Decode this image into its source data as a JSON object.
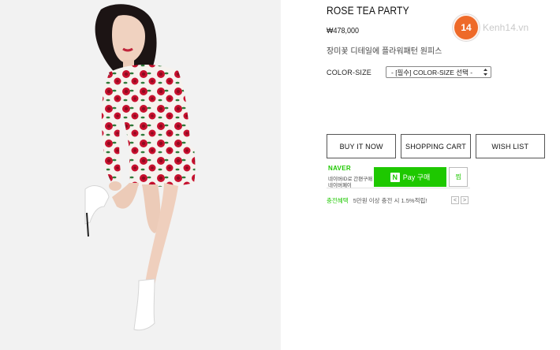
{
  "product": {
    "title": "ROSE TEA PARTY",
    "price": "₩478,000",
    "description": "장미꽃 디테일에 플라워패턴 원피스"
  },
  "option": {
    "label": "COLOR-SIZE",
    "selected": "- [필수] COLOR-SIZE 선택 -"
  },
  "buttons": {
    "buy_now": "BUY IT NOW",
    "shopping_cart": "SHOPPING CART",
    "wish_list": "WISH LIST"
  },
  "naver_pay": {
    "logo": "NAVER",
    "line1": "네이버ID로 간편구매",
    "line2": "네이버페이",
    "pay_label": "Pay 구매",
    "n_icon": "N",
    "zzim_label": "찜",
    "reward_tag": "충전혜택",
    "reward_text": "5만원 이상 충전 시 1.5%적립!",
    "prev": "<",
    "next": ">"
  },
  "watermark": {
    "badge": "14",
    "text": "Kenh14.vn"
  },
  "colors": {
    "naver_green": "#1ec800",
    "watermark_orange": "#ee6a29",
    "dress_red": "#c8102e"
  },
  "photo": {
    "subject": "model-in-rose-print-dress"
  }
}
